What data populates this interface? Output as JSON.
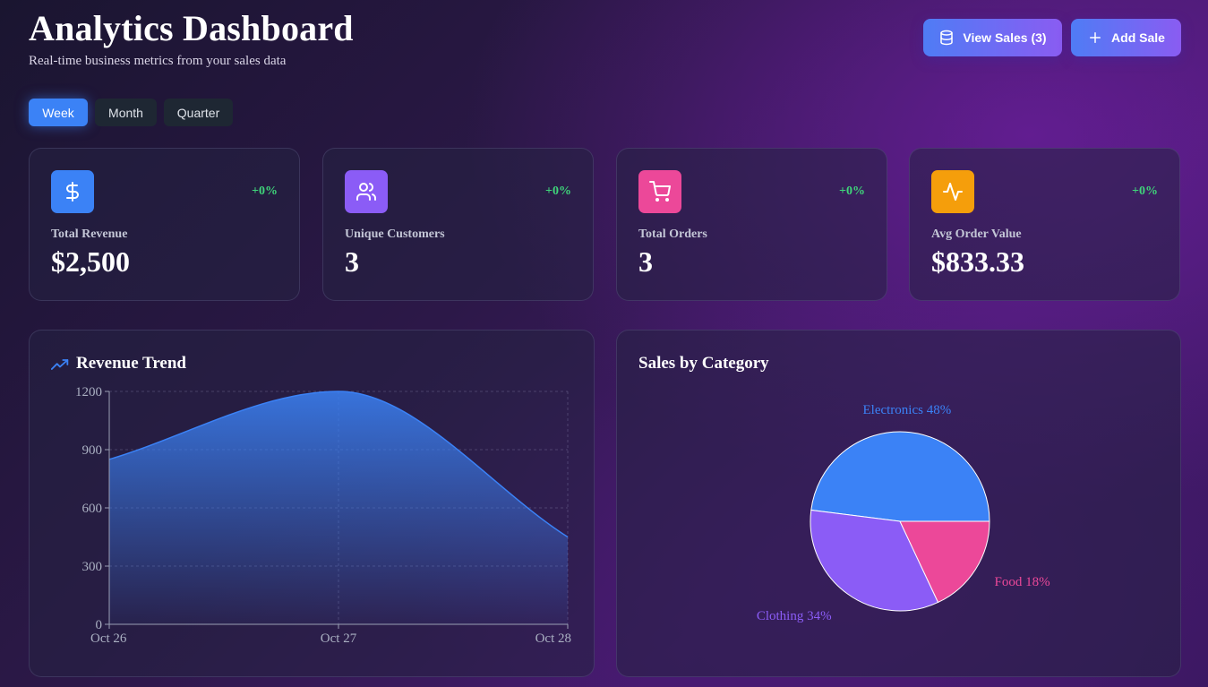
{
  "header": {
    "title": "Analytics Dashboard",
    "subtitle": "Real-time business metrics from your sales data",
    "view_sales_label": "View Sales (3)",
    "add_sale_label": "Add Sale"
  },
  "periods": [
    {
      "label": "Week",
      "active": true
    },
    {
      "label": "Month",
      "active": false
    },
    {
      "label": "Quarter",
      "active": false
    }
  ],
  "stats": [
    {
      "label": "Total Revenue",
      "value": "$2,500",
      "change": "+0%",
      "icon": "dollar-icon",
      "color": "#3b82f6"
    },
    {
      "label": "Unique Customers",
      "value": "3",
      "change": "+0%",
      "icon": "users-icon",
      "color": "#8b5cf6"
    },
    {
      "label": "Total Orders",
      "value": "3",
      "change": "+0%",
      "icon": "cart-icon",
      "color": "#ec4899"
    },
    {
      "label": "Avg Order Value",
      "value": "$833.33",
      "change": "+0%",
      "icon": "activity-icon",
      "color": "#f59e0b"
    }
  ],
  "chart_data": [
    {
      "type": "area",
      "title": "Revenue Trend",
      "x": [
        "Oct 26",
        "Oct 27",
        "Oct 28"
      ],
      "y": [
        850,
        1200,
        450
      ],
      "yticks": [
        0,
        300,
        600,
        900,
        1200
      ],
      "ylim": [
        0,
        1200
      ],
      "grid": true,
      "color": "#3b82f6"
    },
    {
      "type": "pie",
      "title": "Sales by Category",
      "slices": [
        {
          "label": "Electronics 48%",
          "value": 48,
          "color": "#3b82f6"
        },
        {
          "label": "Clothing 34%",
          "value": 34,
          "color": "#8b5cf6"
        },
        {
          "label": "Food 18%",
          "value": 18,
          "color": "#ec4899"
        }
      ]
    }
  ]
}
